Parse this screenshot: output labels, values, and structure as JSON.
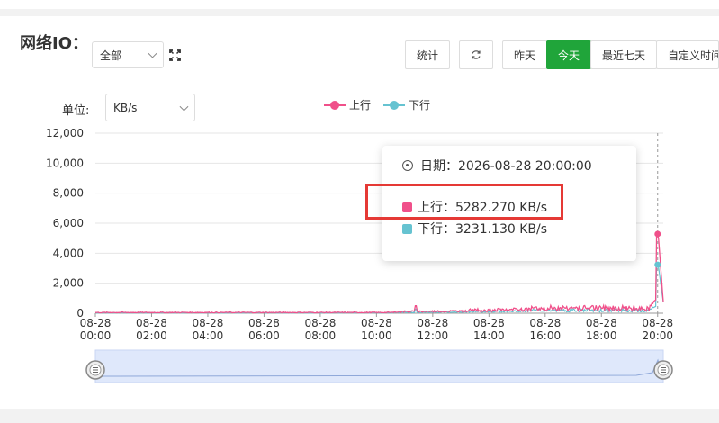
{
  "section": {
    "title": "网络IO：",
    "filter_value": "全部",
    "expand_icon": "expand-icon",
    "buttons": {
      "stats": "统计",
      "refresh_icon": "refresh-icon",
      "yesterday": "昨天",
      "today": "今天",
      "last7": "最近七天",
      "custom": "自定义时间"
    },
    "unit_label": "单位:",
    "unit_value": "KB/s"
  },
  "colors": {
    "up": "#f0508a",
    "down": "#66c3d1",
    "active": "#20a53a"
  },
  "tooltip": {
    "date": "日期：2026-08-28 20:00:00",
    "up": "上行：5282.270 KB/s",
    "down": "下行：3231.130 KB/s"
  },
  "chart_data": {
    "type": "line",
    "title": "",
    "series": [
      {
        "name": "上行",
        "peak": 5282.27
      },
      {
        "name": "下行",
        "peak": 3231.13
      }
    ],
    "y_ticks": [
      "12,000",
      "10,000",
      "8,000",
      "6,000",
      "4,000",
      "2,000",
      "0"
    ],
    "ylim": [
      0,
      12000
    ],
    "x_ticks": [
      [
        "08-28",
        "00:00"
      ],
      [
        "08-28",
        "02:00"
      ],
      [
        "08-28",
        "04:00"
      ],
      [
        "08-28",
        "06:00"
      ],
      [
        "08-28",
        "08:00"
      ],
      [
        "08-28",
        "10:00"
      ],
      [
        "08-28",
        "12:00"
      ],
      [
        "08-28",
        "14:00"
      ],
      [
        "08-28",
        "16:00"
      ],
      [
        "08-28",
        "18:00"
      ],
      [
        "08-28",
        "20:00"
      ]
    ],
    "x_hours": [
      0,
      20.2
    ],
    "grid": true,
    "legend": "top-center"
  }
}
